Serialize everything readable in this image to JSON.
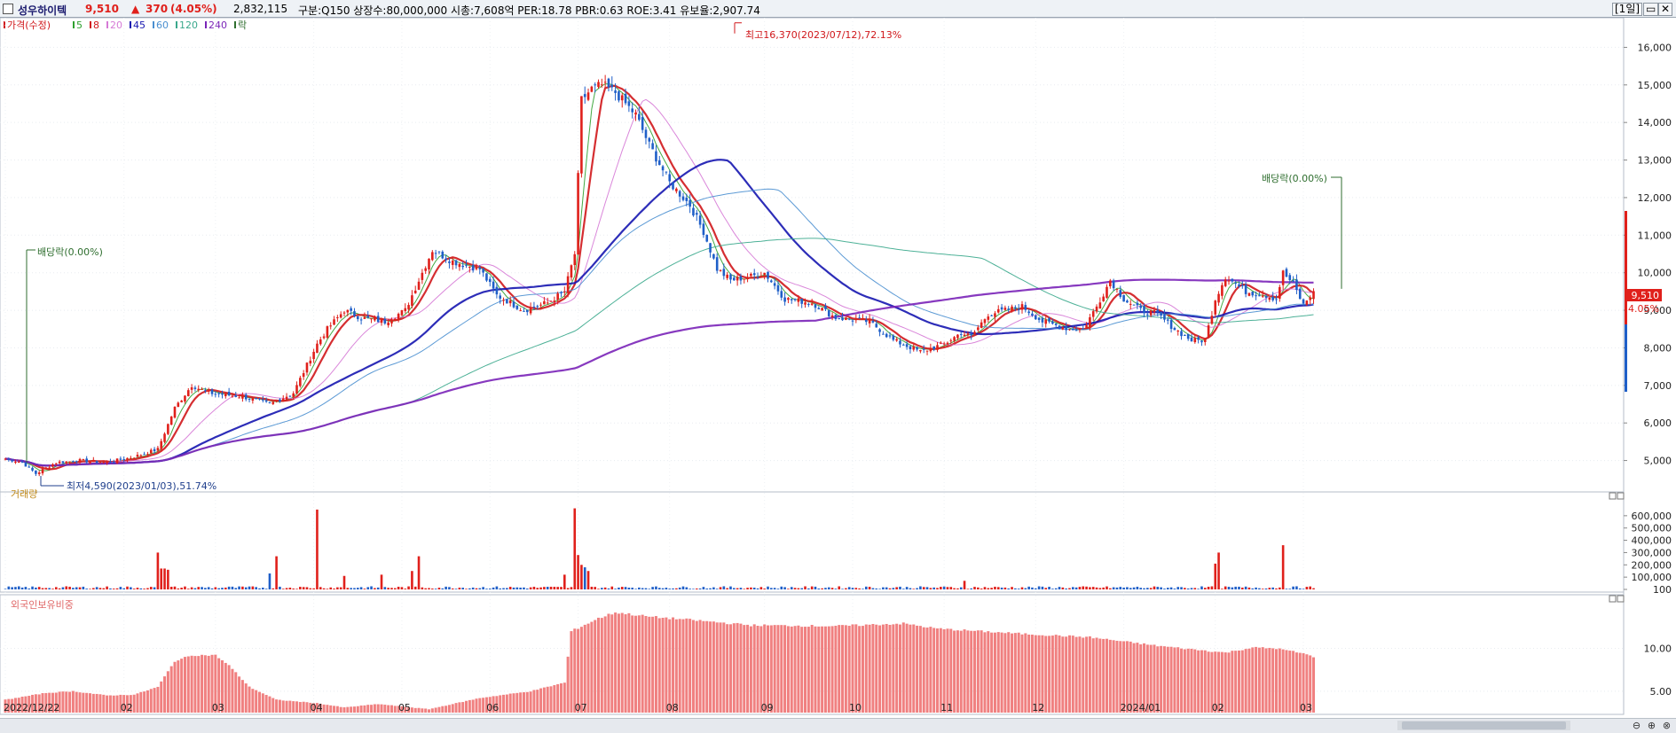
{
  "header": {
    "stock_name": "성우하이텍",
    "price": "9,510",
    "change_arrow": "▲",
    "change": "370",
    "change_pct": "(4.05%)",
    "volume": "2,832,115",
    "info": "구분:Q150 상장수:80,000,000 시총:7,608억 PER:18.78 PBR:0.63 ROE:3.41 유보율:2,907.74",
    "period_button": "[1일]",
    "colors": {
      "up": "#e0201b",
      "down": "#1f5fc8",
      "title": "#1a1a6e"
    }
  },
  "legend": {
    "items": [
      {
        "label": "가격(수정)",
        "color": "#d0171b"
      },
      {
        "label": "5",
        "color": "#2fa02f"
      },
      {
        "label": "8",
        "color": "#d0171b"
      },
      {
        "label": "20",
        "color": "#d67ad6"
      },
      {
        "label": "45",
        "color": "#1616b0"
      },
      {
        "label": "60",
        "color": "#4a8fd0"
      },
      {
        "label": "120",
        "color": "#3aa88c"
      },
      {
        "label": "240",
        "color": "#7a24b8"
      },
      {
        "label": "락",
        "color": "#2f6e2f"
      }
    ]
  },
  "annotations": {
    "high": "최고16,370(2023/07/12),72.13%",
    "low": "최저4,590(2023/01/03),51.74%",
    "dividend_left": "배당락(0.00%)",
    "dividend_right": "배당락(0.00%)",
    "last_price_tag": "9,510",
    "last_pct_tag": "4.05%"
  },
  "panels": {
    "volume_title": "거래량",
    "foreign_title": "외국인보유비중"
  },
  "chart_data": [
    {
      "type": "candlestick",
      "title": "가격(수정)",
      "ylim": [
        4400,
        16600
      ],
      "yticks": [
        "5,000",
        "6,000",
        "7,000",
        "8,000",
        "9,000",
        "10,000",
        "11,000",
        "12,000",
        "13,000",
        "14,000",
        "15,000",
        "16,000"
      ],
      "ytick_values": [
        5000,
        6000,
        7000,
        8000,
        9000,
        10000,
        11000,
        12000,
        13000,
        14000,
        15000,
        16000
      ],
      "x_labels": [
        "2022/12/22",
        "02",
        "03",
        "04",
        "05",
        "06",
        "07",
        "08",
        "09",
        "10",
        "11",
        "12",
        "2024/01",
        "02",
        "03"
      ],
      "x_label_index": [
        0,
        35,
        62,
        91,
        117,
        143,
        169,
        196,
        224,
        250,
        277,
        304,
        330,
        357,
        383
      ],
      "n_bars": 387,
      "close_anchors": [
        [
          0,
          5050
        ],
        [
          5,
          4950
        ],
        [
          9,
          4650
        ],
        [
          15,
          4950
        ],
        [
          22,
          5000
        ],
        [
          30,
          4950
        ],
        [
          38,
          5100
        ],
        [
          45,
          5300
        ],
        [
          50,
          6400
        ],
        [
          55,
          7000
        ],
        [
          60,
          6800
        ],
        [
          70,
          6700
        ],
        [
          78,
          6500
        ],
        [
          85,
          6800
        ],
        [
          92,
          8100
        ],
        [
          95,
          8500
        ],
        [
          100,
          9000
        ],
        [
          105,
          8800
        ],
        [
          112,
          8700
        ],
        [
          118,
          9000
        ],
        [
          122,
          9800
        ],
        [
          126,
          10600
        ],
        [
          132,
          10300
        ],
        [
          140,
          10100
        ],
        [
          145,
          9400
        ],
        [
          153,
          9000
        ],
        [
          160,
          9200
        ],
        [
          165,
          9500
        ],
        [
          168,
          10500
        ],
        [
          170,
          14600
        ],
        [
          173,
          14900
        ],
        [
          176,
          15000
        ],
        [
          180,
          14800
        ],
        [
          186,
          14200
        ],
        [
          190,
          13400
        ],
        [
          196,
          12400
        ],
        [
          202,
          11800
        ],
        [
          206,
          11100
        ],
        [
          210,
          10100
        ],
        [
          214,
          9800
        ],
        [
          220,
          9900
        ],
        [
          224,
          10000
        ],
        [
          230,
          9300
        ],
        [
          238,
          9200
        ],
        [
          245,
          8800
        ],
        [
          255,
          8700
        ],
        [
          262,
          8200
        ],
        [
          270,
          7900
        ],
        [
          277,
          8100
        ],
        [
          282,
          8400
        ],
        [
          285,
          8300
        ],
        [
          290,
          8900
        ],
        [
          300,
          9100
        ],
        [
          306,
          8700
        ],
        [
          314,
          8500
        ],
        [
          318,
          8500
        ],
        [
          322,
          9100
        ],
        [
          326,
          9800
        ],
        [
          330,
          9300
        ],
        [
          335,
          9000
        ],
        [
          340,
          8900
        ],
        [
          345,
          8500
        ],
        [
          350,
          8200
        ],
        [
          354,
          8200
        ],
        [
          357,
          9300
        ],
        [
          360,
          9900
        ],
        [
          366,
          9500
        ],
        [
          372,
          9400
        ],
        [
          375,
          9300
        ],
        [
          377,
          10000
        ],
        [
          380,
          9700
        ],
        [
          383,
          9140
        ],
        [
          386,
          9510
        ]
      ],
      "ma_periods": [
        5,
        8,
        20,
        45,
        60,
        120,
        240
      ],
      "last_price": 9510,
      "high": {
        "value": 16370,
        "date": "2023/07/12",
        "pct": 72.13
      },
      "low": {
        "value": 4590,
        "date": "2023/01/03",
        "pct": 51.74
      }
    },
    {
      "type": "bar",
      "title": "거래량",
      "ylim": [
        0,
        700000
      ],
      "yticks": [
        "100",
        "100,000",
        "200,000",
        "300,000",
        "400,000",
        "500,000",
        "600,000"
      ],
      "ytick_values": [
        100,
        100000,
        200000,
        300000,
        400000,
        500000,
        600000
      ],
      "spikes": [
        [
          45,
          300000
        ],
        [
          46,
          170000
        ],
        [
          47,
          170000
        ],
        [
          48,
          160000
        ],
        [
          78,
          130000
        ],
        [
          80,
          270000
        ],
        [
          92,
          650000
        ],
        [
          100,
          110000
        ],
        [
          111,
          120000
        ],
        [
          120,
          150000
        ],
        [
          122,
          270000
        ],
        [
          165,
          120000
        ],
        [
          168,
          660000
        ],
        [
          169,
          280000
        ],
        [
          170,
          200000
        ],
        [
          171,
          180000
        ],
        [
          172,
          150000
        ],
        [
          283,
          70000
        ],
        [
          357,
          210000
        ],
        [
          358,
          300000
        ],
        [
          377,
          360000
        ]
      ],
      "baseline": 15000
    },
    {
      "type": "bar",
      "title": "외국인보유비중",
      "ylim": [
        2.5,
        14.5
      ],
      "yticks": [
        "5.00",
        "10.00"
      ],
      "ytick_values": [
        5,
        10
      ],
      "anchors": [
        [
          0,
          4.0
        ],
        [
          12,
          4.8
        ],
        [
          20,
          5.0
        ],
        [
          30,
          4.5
        ],
        [
          38,
          4.6
        ],
        [
          45,
          5.5
        ],
        [
          50,
          8.5
        ],
        [
          55,
          9.2
        ],
        [
          62,
          9.2
        ],
        [
          66,
          8.0
        ],
        [
          72,
          5.5
        ],
        [
          80,
          4.0
        ],
        [
          92,
          3.6
        ],
        [
          100,
          3.1
        ],
        [
          110,
          3.5
        ],
        [
          125,
          2.9
        ],
        [
          140,
          4.2
        ],
        [
          155,
          5.0
        ],
        [
          165,
          6.0
        ],
        [
          167,
          12.0
        ],
        [
          175,
          13.5
        ],
        [
          180,
          14.2
        ],
        [
          190,
          13.7
        ],
        [
          200,
          13.4
        ],
        [
          220,
          12.7
        ],
        [
          245,
          12.6
        ],
        [
          265,
          12.9
        ],
        [
          275,
          12.3
        ],
        [
          300,
          11.7
        ],
        [
          320,
          11.3
        ],
        [
          340,
          10.3
        ],
        [
          360,
          9.5
        ],
        [
          368,
          10.1
        ],
        [
          375,
          10.0
        ],
        [
          383,
          9.4
        ],
        [
          386,
          9.0
        ]
      ]
    }
  ]
}
